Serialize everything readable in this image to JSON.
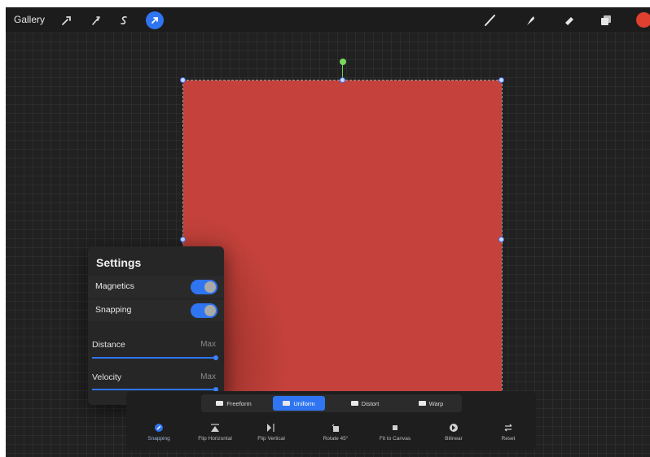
{
  "topbar": {
    "gallery_label": "Gallery",
    "left_icons": [
      "wrench-icon",
      "magic-wand-icon",
      "selection-s-icon",
      "cursor-arrow-icon"
    ],
    "active_tool": "cursor-arrow-icon",
    "right_icons": [
      "brush-icon",
      "smudge-icon",
      "eraser-icon",
      "layers-icon"
    ],
    "current_color": "#e0402f"
  },
  "canvas": {
    "artwork_color": "#c4423b",
    "handle_color": "#3b6ef2",
    "rotation_handle_color": "#7bd85f"
  },
  "settings": {
    "title": "Settings",
    "toggles": [
      {
        "label": "Magnetics",
        "on": true
      },
      {
        "label": "Snapping",
        "on": true
      }
    ],
    "sliders": [
      {
        "label": "Distance",
        "value_label": "Max",
        "value": 1.0
      },
      {
        "label": "Velocity",
        "value_label": "Max",
        "value": 1.0
      }
    ]
  },
  "transform": {
    "modes": [
      {
        "label": "Freeform",
        "active": false
      },
      {
        "label": "Uniform",
        "active": true
      },
      {
        "label": "Distort",
        "active": false
      },
      {
        "label": "Warp",
        "active": false
      }
    ],
    "tools": [
      {
        "label": "Snapping",
        "icon": "snapping-icon",
        "active": true
      },
      {
        "label": "Flip Horizontal",
        "icon": "flip-horizontal-icon",
        "active": false
      },
      {
        "label": "Flip Vertical",
        "icon": "flip-vertical-icon",
        "active": false
      },
      {
        "label": "Rotate 45°",
        "icon": "rotate-icon",
        "active": false
      },
      {
        "label": "Fit to Canvas",
        "icon": "fit-canvas-icon",
        "active": false
      },
      {
        "label": "Bilinear",
        "icon": "interpolation-icon",
        "active": false
      },
      {
        "label": "Reset",
        "icon": "reset-icon",
        "active": false
      }
    ],
    "accent_color": "#2f74f0"
  }
}
